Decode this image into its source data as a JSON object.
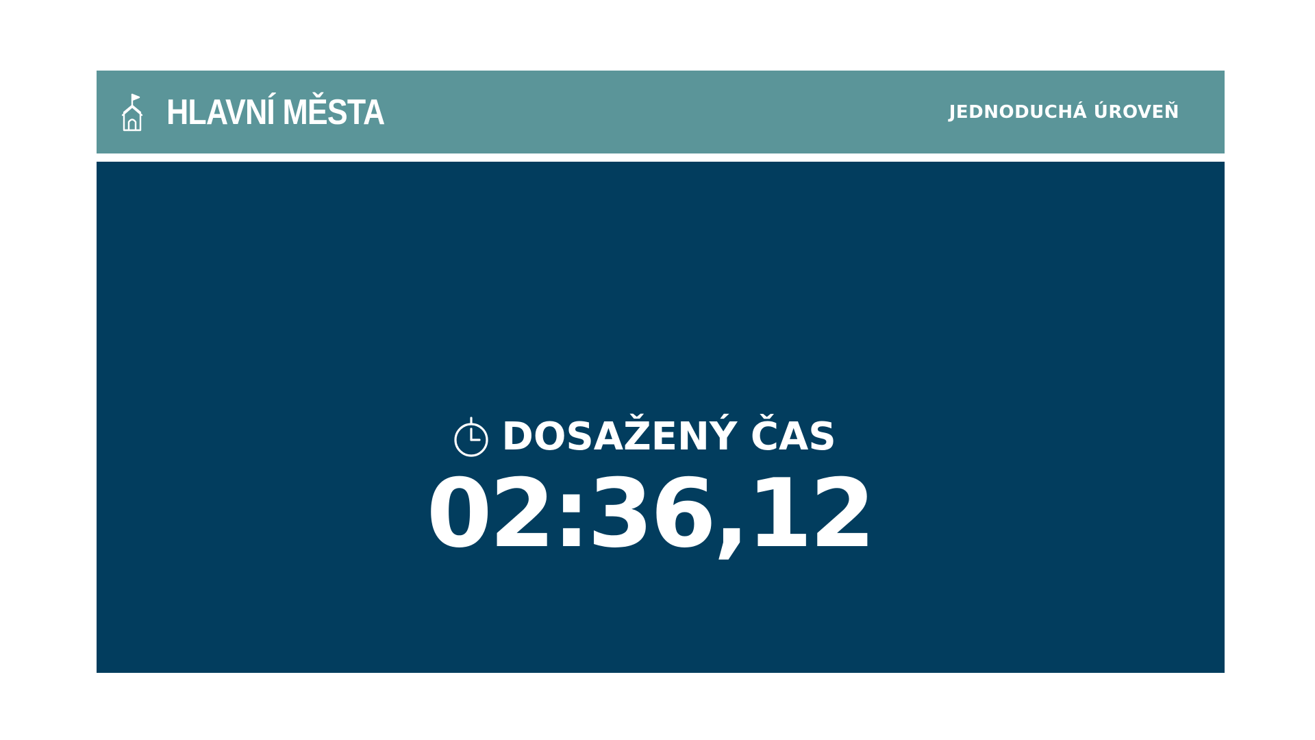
{
  "header": {
    "title": "HLAVNÍ MĚSTA",
    "level": "JEDNODUCHÁ ÚROVEŇ",
    "logo_icon": "town-hall-flag-icon"
  },
  "result": {
    "label": "DOSAŽENÝ ČAS",
    "time": "02:36,12",
    "timer_icon": "stopwatch-icon"
  },
  "colors": {
    "header_bg": "#5b9599",
    "panel_bg": "#023d5e",
    "text": "#ffffff",
    "page_bg": "#ffffff"
  }
}
